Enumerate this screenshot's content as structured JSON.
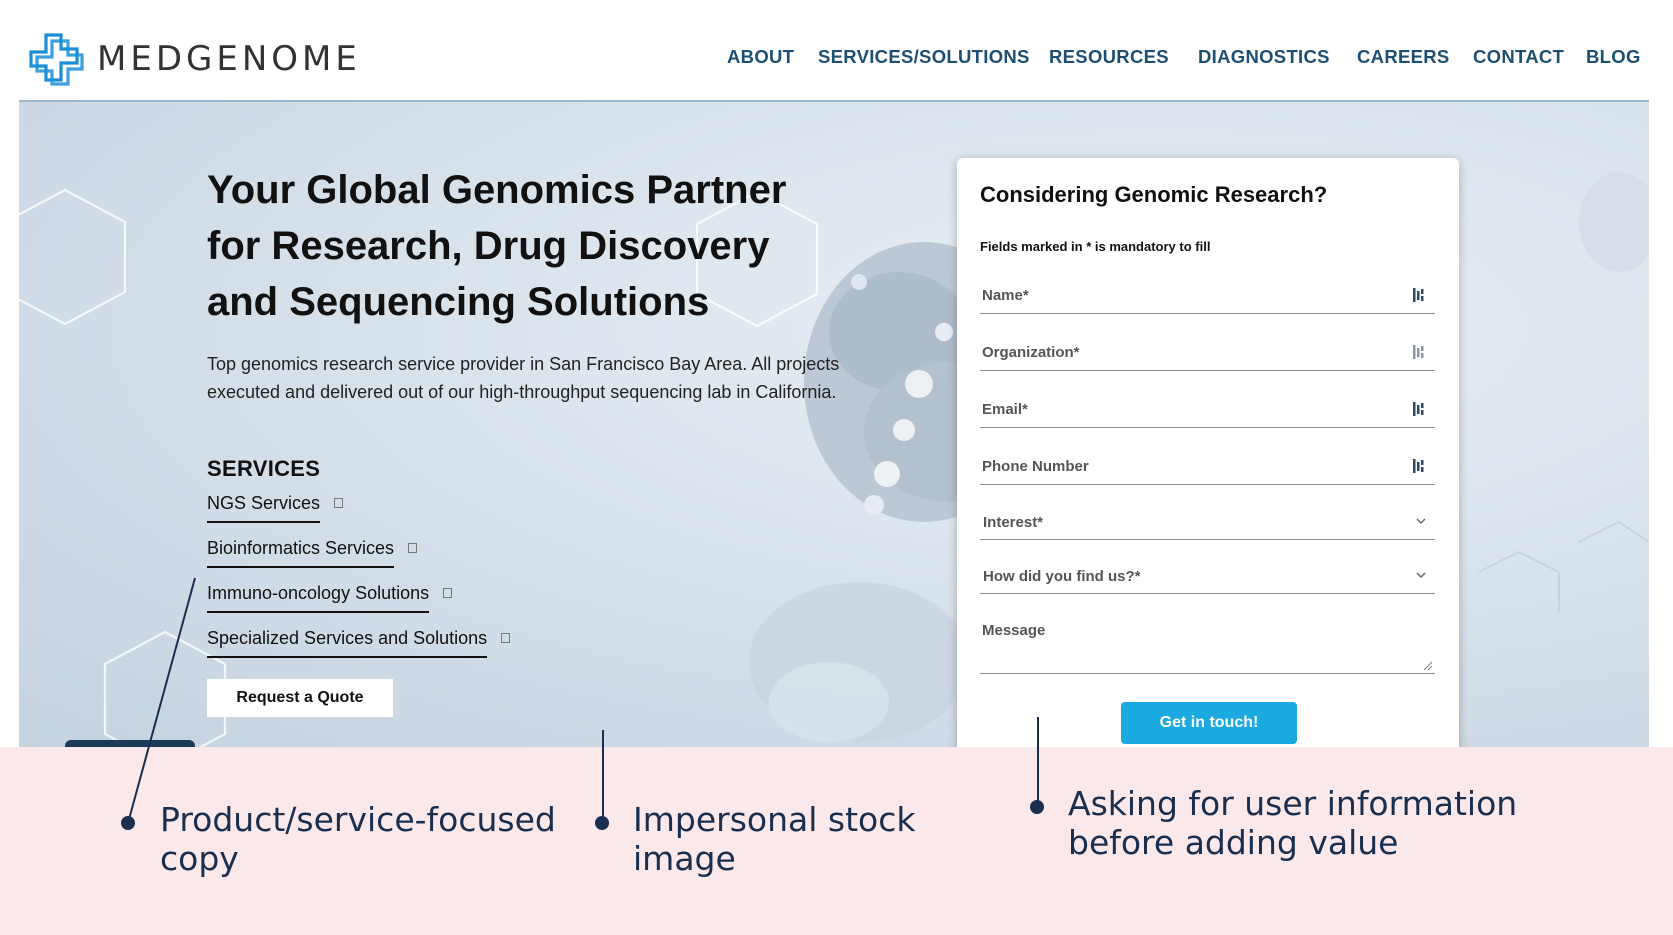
{
  "brand": {
    "name": "MEDGENOME"
  },
  "nav": {
    "items": [
      "ABOUT",
      "SERVICES/SOLUTIONS",
      "RESOURCES",
      "DIAGNOSTICS",
      "CAREERS",
      "CONTACT",
      "BLOG"
    ]
  },
  "hero": {
    "title_line1": "Your Global Genomics Partner",
    "title_line2": "for Research, Drug Discovery",
    "title_line3": "and Sequencing Solutions",
    "subtitle_line1": "Top genomics research service provider in San Francisco Bay Area. All projects",
    "subtitle_line2": "executed and delivered out of our high-throughput sequencing lab in California.",
    "services_heading": "SERVICES",
    "services": [
      "NGS Services",
      "Bioinformatics Services",
      "Immuno-oncology Solutions",
      "Specialized Services and Solutions"
    ],
    "quote_button": "Request a Quote"
  },
  "form": {
    "title": "Considering Genomic Research?",
    "note": "Fields marked in * is mandatory to fill",
    "name_placeholder": "Name*",
    "organization_placeholder": "Organization*",
    "email_placeholder": "Email*",
    "phone_placeholder": "Phone Number",
    "interest_select": "Interest*",
    "source_select": "How did you find us?*",
    "message_placeholder": "Message",
    "submit_label": "Get in touch!"
  },
  "annotations": {
    "callout1_line1": "Product/service-focused",
    "callout1_line2": "copy",
    "callout2_line1": "Impersonal stock",
    "callout2_line2": "image",
    "callout3_line1": "Asking for user information",
    "callout3_line2": "before adding value"
  },
  "colors": {
    "nav_text": "#1d4f73",
    "logo_blue": "#1a8fd8",
    "submit_button": "#1aa9e0",
    "annotation_band": "#fae8ea",
    "annotation_text": "#1a2e4f"
  },
  "icons": [
    "logo-cross-icon",
    "autofill-icon",
    "chevron-down-icon",
    "square-icon",
    "resize-grip-icon"
  ]
}
